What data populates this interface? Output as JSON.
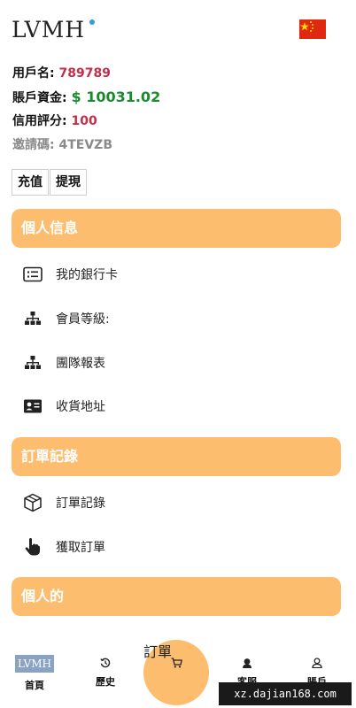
{
  "header": {
    "logo": "LVMH",
    "flag_icon": "china-flag-icon"
  },
  "user": {
    "username_label": "用戶名:",
    "username": "789789",
    "balance_label": "賬戶資金:",
    "balance": "$ 10031.02",
    "credit_label": "信用評分:",
    "credit": "100",
    "invite_label": "邀請碼:",
    "invite": "4TEVZB"
  },
  "actions": {
    "recharge": "充值",
    "withdraw": "提現"
  },
  "sections": [
    {
      "title": "個人信息",
      "items": [
        {
          "label": "我的銀行卡",
          "icon": "bank-card-icon"
        },
        {
          "label": "會員等級:",
          "icon": "hierarchy-icon"
        },
        {
          "label": "團隊報表",
          "icon": "hierarchy-icon"
        },
        {
          "label": "收貨地址",
          "icon": "address-card-icon"
        }
      ]
    },
    {
      "title": "訂單記錄",
      "items": [
        {
          "label": "訂單記錄",
          "icon": "box-icon"
        },
        {
          "label": "獲取訂單",
          "icon": "pointer-hand-icon"
        }
      ]
    },
    {
      "title": "個人的",
      "items": []
    }
  ],
  "nav": {
    "home": "首頁",
    "history": "歷史",
    "order": "訂單",
    "service": "客服",
    "account": "賬戶"
  },
  "watermark": "xz.dajian168.com",
  "colors": {
    "accent": "#fdbd6f",
    "red": "#c0304a",
    "green": "#1b8a2e"
  }
}
